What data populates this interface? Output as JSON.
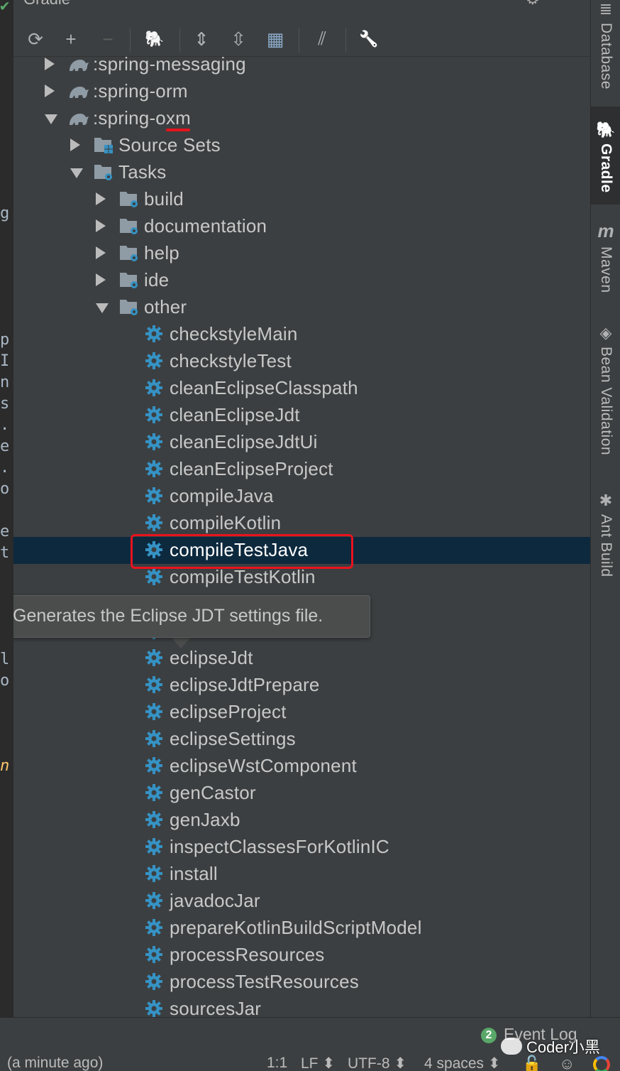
{
  "panel": {
    "title": "Gradle",
    "toolbar": [
      {
        "name": "refresh-icon",
        "glyph": "⟳"
      },
      {
        "name": "add-icon",
        "glyph": "+"
      },
      {
        "name": "remove-icon",
        "glyph": "−"
      },
      {
        "name": "elephant-icon",
        "glyph": "🐘"
      },
      {
        "name": "expand-all-icon",
        "glyph": "⇕"
      },
      {
        "name": "collapse-all-icon",
        "glyph": "⇳"
      },
      {
        "name": "group-modules-icon",
        "glyph": "▦"
      },
      {
        "name": "toggle-offline-icon",
        "glyph": "⫽"
      },
      {
        "name": "wrench-icon",
        "glyph": "🔧"
      }
    ]
  },
  "tree": [
    {
      "label": ":spring-messaging",
      "type": "module",
      "expanded": false
    },
    {
      "label": ":spring-orm",
      "type": "module",
      "expanded": false
    },
    {
      "label": ":spring-oxm",
      "type": "module",
      "expanded": true
    },
    {
      "label": "Source Sets",
      "type": "folder",
      "expanded": false
    },
    {
      "label": "Tasks",
      "type": "taskfolder",
      "expanded": true
    },
    {
      "label": "build",
      "type": "taskfolder",
      "expanded": false
    },
    {
      "label": "documentation",
      "type": "taskfolder",
      "expanded": false
    },
    {
      "label": "help",
      "type": "taskfolder",
      "expanded": false
    },
    {
      "label": "ide",
      "type": "taskfolder",
      "expanded": false
    },
    {
      "label": "other",
      "type": "taskfolder",
      "expanded": true
    },
    {
      "label": "checkstyleMain",
      "type": "task"
    },
    {
      "label": "checkstyleTest",
      "type": "task"
    },
    {
      "label": "cleanEclipseClasspath",
      "type": "task"
    },
    {
      "label": "cleanEclipseJdt",
      "type": "task"
    },
    {
      "label": "cleanEclipseJdtUi",
      "type": "task"
    },
    {
      "label": "cleanEclipseProject",
      "type": "task"
    },
    {
      "label": "compileJava",
      "type": "task"
    },
    {
      "label": "compileKotlin",
      "type": "task"
    },
    {
      "label": "compileTestJava",
      "type": "task",
      "selected": true
    },
    {
      "label": "compileTestKotlin",
      "type": "task"
    },
    {
      "label": "",
      "type": "task"
    },
    {
      "label": "",
      "type": "task"
    },
    {
      "label": "eclipseJdt",
      "type": "task"
    },
    {
      "label": "eclipseJdtPrepare",
      "type": "task"
    },
    {
      "label": "eclipseProject",
      "type": "task"
    },
    {
      "label": "eclipseSettings",
      "type": "task"
    },
    {
      "label": "eclipseWstComponent",
      "type": "task"
    },
    {
      "label": "genCastor",
      "type": "task"
    },
    {
      "label": "genJaxb",
      "type": "task"
    },
    {
      "label": "inspectClassesForKotlinIC",
      "type": "task"
    },
    {
      "label": "install",
      "type": "task"
    },
    {
      "label": "javadocJar",
      "type": "task"
    },
    {
      "label": "prepareKotlinBuildScriptModel",
      "type": "task"
    },
    {
      "label": "processResources",
      "type": "task"
    },
    {
      "label": "processTestResources",
      "type": "task"
    },
    {
      "label": "sourcesJar",
      "type": "task"
    }
  ],
  "tooltip": {
    "text": "Generates the Eclipse JDT settings file."
  },
  "right_tabs": [
    {
      "label": "Database",
      "icon": "database-icon",
      "glyph": "≣"
    },
    {
      "label": "Gradle",
      "icon": "gradle-elephant-icon",
      "glyph": "🐘",
      "active": true
    },
    {
      "label": "Maven",
      "icon": "maven-icon",
      "glyph": "m"
    },
    {
      "label": "Bean Validation",
      "icon": "bean-validation-icon",
      "glyph": "◈"
    },
    {
      "label": "Ant Build",
      "icon": "ant-icon",
      "glyph": "✱"
    }
  ],
  "editor_fragments": [
    "g",
    "p",
    "I",
    "n",
    "s",
    ".",
    "e",
    ".",
    "o",
    "e",
    "t",
    "l",
    "o",
    "n"
  ],
  "statusbar": {
    "event_count": "2",
    "event_log": "Event Log",
    "watermark": "Coder小黑",
    "left_text": "(a minute ago)",
    "position": "1:1",
    "line_sep": "LF ⬍",
    "encoding": "UTF-8 ⬍",
    "indent": "4 spaces ⬍"
  },
  "colors": {
    "selection": "#0d293e",
    "highlight": "#e8131d",
    "task_gear": "#3592c4"
  }
}
